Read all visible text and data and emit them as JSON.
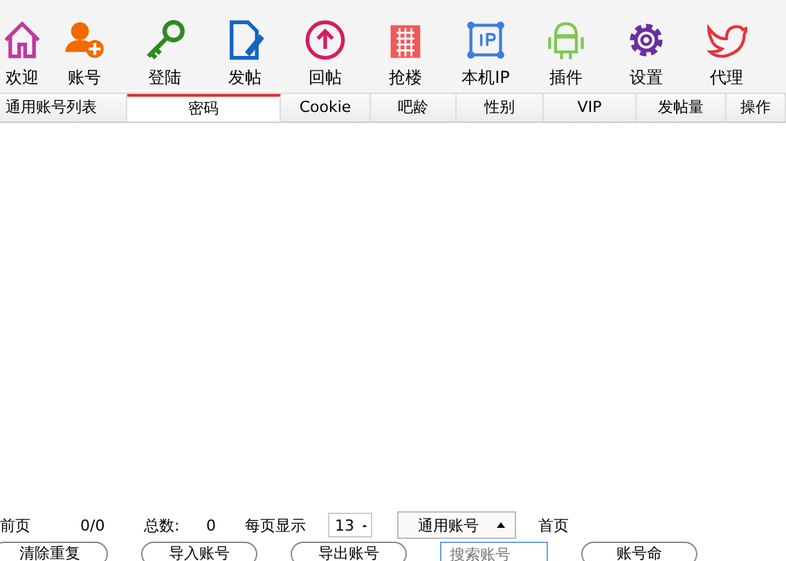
{
  "toolbar": [
    {
      "label": "欢迎",
      "kind": "house"
    },
    {
      "label": "账号",
      "kind": "account"
    },
    {
      "label": "登陆",
      "kind": "key"
    },
    {
      "label": "发帖",
      "kind": "document"
    },
    {
      "label": "回帖",
      "kind": "upload"
    },
    {
      "label": "抢楼",
      "kind": "building"
    },
    {
      "label": "本机IP",
      "kind": "ip"
    },
    {
      "label": "插件",
      "kind": "android"
    },
    {
      "label": "设置",
      "kind": "gear"
    },
    {
      "label": "代理",
      "kind": "bird"
    }
  ],
  "table": {
    "columns": [
      {
        "label": "通用账号列表",
        "selected": false
      },
      {
        "label": "密码",
        "selected": true
      },
      {
        "label": "Cookie",
        "selected": false
      },
      {
        "label": "吧龄",
        "selected": false
      },
      {
        "label": "性别",
        "selected": false
      },
      {
        "label": "VIP",
        "selected": false
      },
      {
        "label": "发帖量",
        "selected": false
      },
      {
        "label": "操作",
        "selected": false
      }
    ]
  },
  "pager": {
    "current_label": "前页",
    "current": "0/0",
    "total_label": "总数:",
    "total": "0",
    "per_page_label": "每页显示",
    "per_page": "13",
    "account_type": "通用账号",
    "first": "首页"
  },
  "buttons": [
    {
      "label": "清除重复",
      "kind": "button"
    },
    {
      "label": "导入账号",
      "kind": "button"
    },
    {
      "label": "导出账号",
      "kind": "button"
    },
    {
      "placeholder": "搜索账号",
      "kind": "search"
    },
    {
      "label": "账号命",
      "kind": "button"
    }
  ]
}
